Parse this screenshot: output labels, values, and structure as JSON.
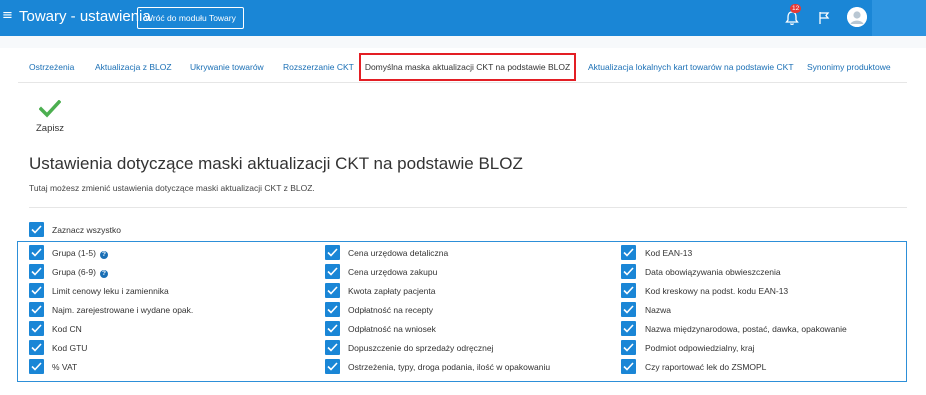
{
  "header": {
    "title": "Towary - ustawienia",
    "back_button": "Wróć do modułu Towary",
    "notifications_count": "12",
    "icons": [
      "menu-icon",
      "bell-icon",
      "flag-icon",
      "avatar-icon"
    ]
  },
  "tabs": [
    {
      "label": "Ostrzeżenia"
    },
    {
      "label": "Aktualizacja z BLOZ"
    },
    {
      "label": "Ukrywanie towarów"
    },
    {
      "label": "Rozszerzanie CKT"
    },
    {
      "label": "Domyślna maska aktualizacji CKT na podstawie BLOZ"
    },
    {
      "label": "Aktualizacja lokalnych kart towarów na podstawie CKT"
    },
    {
      "label": "Synonimy produktowe"
    }
  ],
  "toolbar": {
    "save_label": "Zapisz"
  },
  "main": {
    "title": "Ustawienia dotyczące maski aktualizacji CKT na podstawie BLOZ",
    "description": "Tutaj możesz zmienić ustawienia dotyczące maski aktualizacji CKT z BLOZ.",
    "select_all": "Zaznacz wszystko",
    "columns": [
      [
        "Grupa (1-5)",
        "Grupa (6-9)",
        "Limit cenowy leku i zamiennika",
        "Najm. zarejestrowane i wydane opak.",
        "Kod CN",
        "Kod GTU",
        "% VAT"
      ],
      [
        "Cena urzędowa detaliczna",
        "Cena urzędowa zakupu",
        "Kwota zapłaty pacjenta",
        "Odpłatność na recepty",
        "Odpłatność na wniosek",
        "Dopuszczenie do sprzedaży odręcznej",
        "Ostrzeżenia, typy, droga podania, ilość w opakowaniu"
      ],
      [
        "Kod EAN-13",
        "Data obowiązywania obwieszczenia",
        "Kod kreskowy na podst. kodu EAN-13",
        "Nazwa",
        "Nazwa międzynarodowa, postać, dawka, opakowanie",
        "Podmiot odpowiedzialny, kraj",
        "Czy raportować lek do ZSMOPL"
      ]
    ]
  },
  "colors": {
    "accent": "#1a86d6",
    "highlight": "#e31e24",
    "save_check": "#4caf50"
  }
}
